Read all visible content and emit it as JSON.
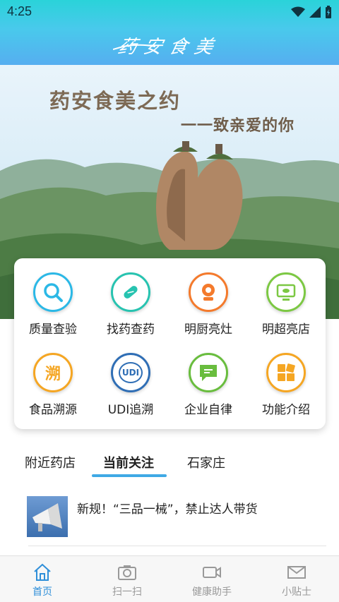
{
  "status_bar": {
    "time": "4:25"
  },
  "header": {
    "logo_text": "药安食美"
  },
  "hero": {
    "title": "药安食美之约",
    "subtitle": "一一致亲爱的你"
  },
  "functions": [
    {
      "label": "质量查验",
      "icon": "search-icon",
      "color": "#2bb8e6"
    },
    {
      "label": "找药查药",
      "icon": "pill-icon",
      "color": "#27c3b0"
    },
    {
      "label": "明厨亮灶",
      "icon": "camera-icon",
      "color": "#f47a2c"
    },
    {
      "label": "明超亮店",
      "icon": "monitor-icon",
      "color": "#7cc843"
    },
    {
      "label": "食品溯源",
      "icon": "trace-icon",
      "icon_text": "溯",
      "color": "#f5a623"
    },
    {
      "label": "UDI追溯",
      "icon": "udi-icon",
      "icon_text": "UDI",
      "color": "#2f6eb5"
    },
    {
      "label": "企业自律",
      "icon": "chat-icon",
      "color": "#69bd3e"
    },
    {
      "label": "功能介绍",
      "icon": "grid-icon",
      "color": "#f5a623"
    }
  ],
  "tabs": [
    {
      "label": "附近药店",
      "active": false
    },
    {
      "label": "当前关注",
      "active": true
    },
    {
      "label": "石家庄",
      "active": false
    }
  ],
  "news": [
    {
      "title": "新规！“三品一械”，禁止达人带货"
    }
  ],
  "bottom_nav": [
    {
      "label": "首页",
      "icon": "home-icon",
      "active": true
    },
    {
      "label": "扫一扫",
      "icon": "camera-scan-icon",
      "active": false
    },
    {
      "label": "健康助手",
      "icon": "video-icon",
      "active": false
    },
    {
      "label": "小贴士",
      "icon": "mail-icon",
      "active": false
    }
  ]
}
